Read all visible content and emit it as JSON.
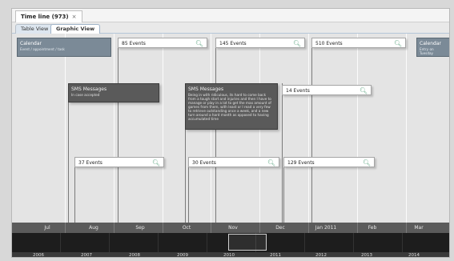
{
  "tab": {
    "title": "Time line (973)",
    "close": "×"
  },
  "viewtabs": [
    {
      "label": "Table View"
    },
    {
      "label": "Graphic View"
    }
  ],
  "cards": [
    {
      "label": "85 Events"
    },
    {
      "label": "145 Events"
    },
    {
      "label": "510 Events"
    },
    {
      "label": "14 Events"
    },
    {
      "label": "37 Events"
    },
    {
      "label": "30 Events"
    },
    {
      "label": "129 Events"
    }
  ],
  "calendar_left": {
    "title": "Calendar",
    "body": "Event / appointment / task"
  },
  "calendar_right": {
    "title": "Calendar",
    "body": "Entry on Tuesday"
  },
  "sms_left": {
    "title": "SMS Messages",
    "body": "In case accepted"
  },
  "sms_right": {
    "title": "SMS Messages",
    "body": "Being in with ridiculous, its hard to come back from a tough start and injuries and then I have to manage or play in a lot to get the max amount of games from them, with least or I read a very few to retrieve outstanding once a week, and a new turn around a hard month as opposed to having accumulated time"
  },
  "months": [
    "Jul",
    "Aug",
    "Sep",
    "Oct",
    "Nov",
    "Dec",
    "Jan 2011",
    "Feb",
    "Mar"
  ],
  "years": [
    "2006",
    "2007",
    "2008",
    "2009",
    "2010",
    "2011",
    "2012",
    "2013",
    "2014"
  ],
  "icons": {
    "magnifier": "magnifier-icon"
  },
  "colors": {
    "dark_box": "#5a5a5a",
    "calendar_box": "#7b8a97",
    "overview_bg": "#1d1d1d"
  }
}
